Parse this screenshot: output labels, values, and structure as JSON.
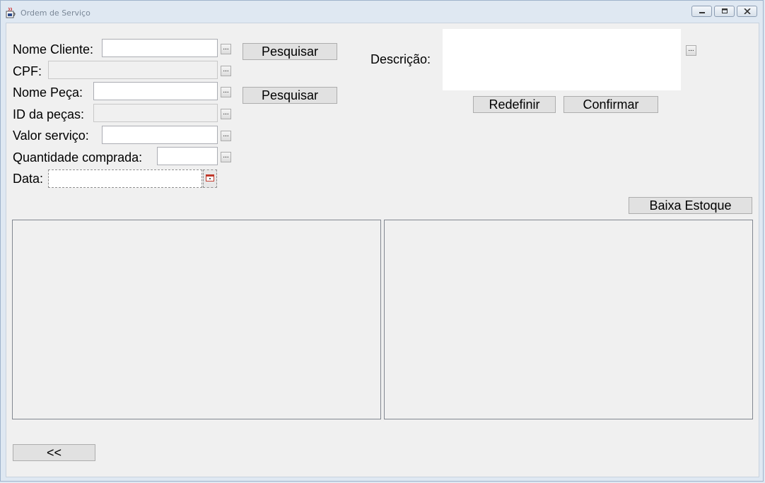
{
  "window": {
    "title": "Ordem de Serviço"
  },
  "form": {
    "nome_cliente_label": "Nome Cliente:",
    "cpf_label": "CPF:",
    "nome_peca_label": "Nome Peça:",
    "id_pecas_label": "ID da peças:",
    "valor_servico_label": "Valor serviço:",
    "quantidade_label": "Quantidade comprada:",
    "data_label": "Data:",
    "descricao_label": "Descrição:",
    "ellipsis": "...",
    "nome_cliente_value": "",
    "cpf_value": "",
    "nome_peca_value": "",
    "id_pecas_value": "",
    "valor_servico_value": "",
    "quantidade_value": "",
    "data_value": "",
    "descricao_value": ""
  },
  "buttons": {
    "pesquisar_cliente": "Pesquisar",
    "pesquisar_peca": "Pesquisar",
    "redefinir": "Redefinir",
    "confirmar": "Confirmar",
    "baixa_estoque": "Baixa Estoque",
    "voltar": "<<"
  },
  "icons": {
    "app": "java-cup-icon",
    "calendar": "calendar-icon",
    "minimize": "minimize-icon",
    "maximize": "maximize-icon",
    "close": "close-icon"
  }
}
